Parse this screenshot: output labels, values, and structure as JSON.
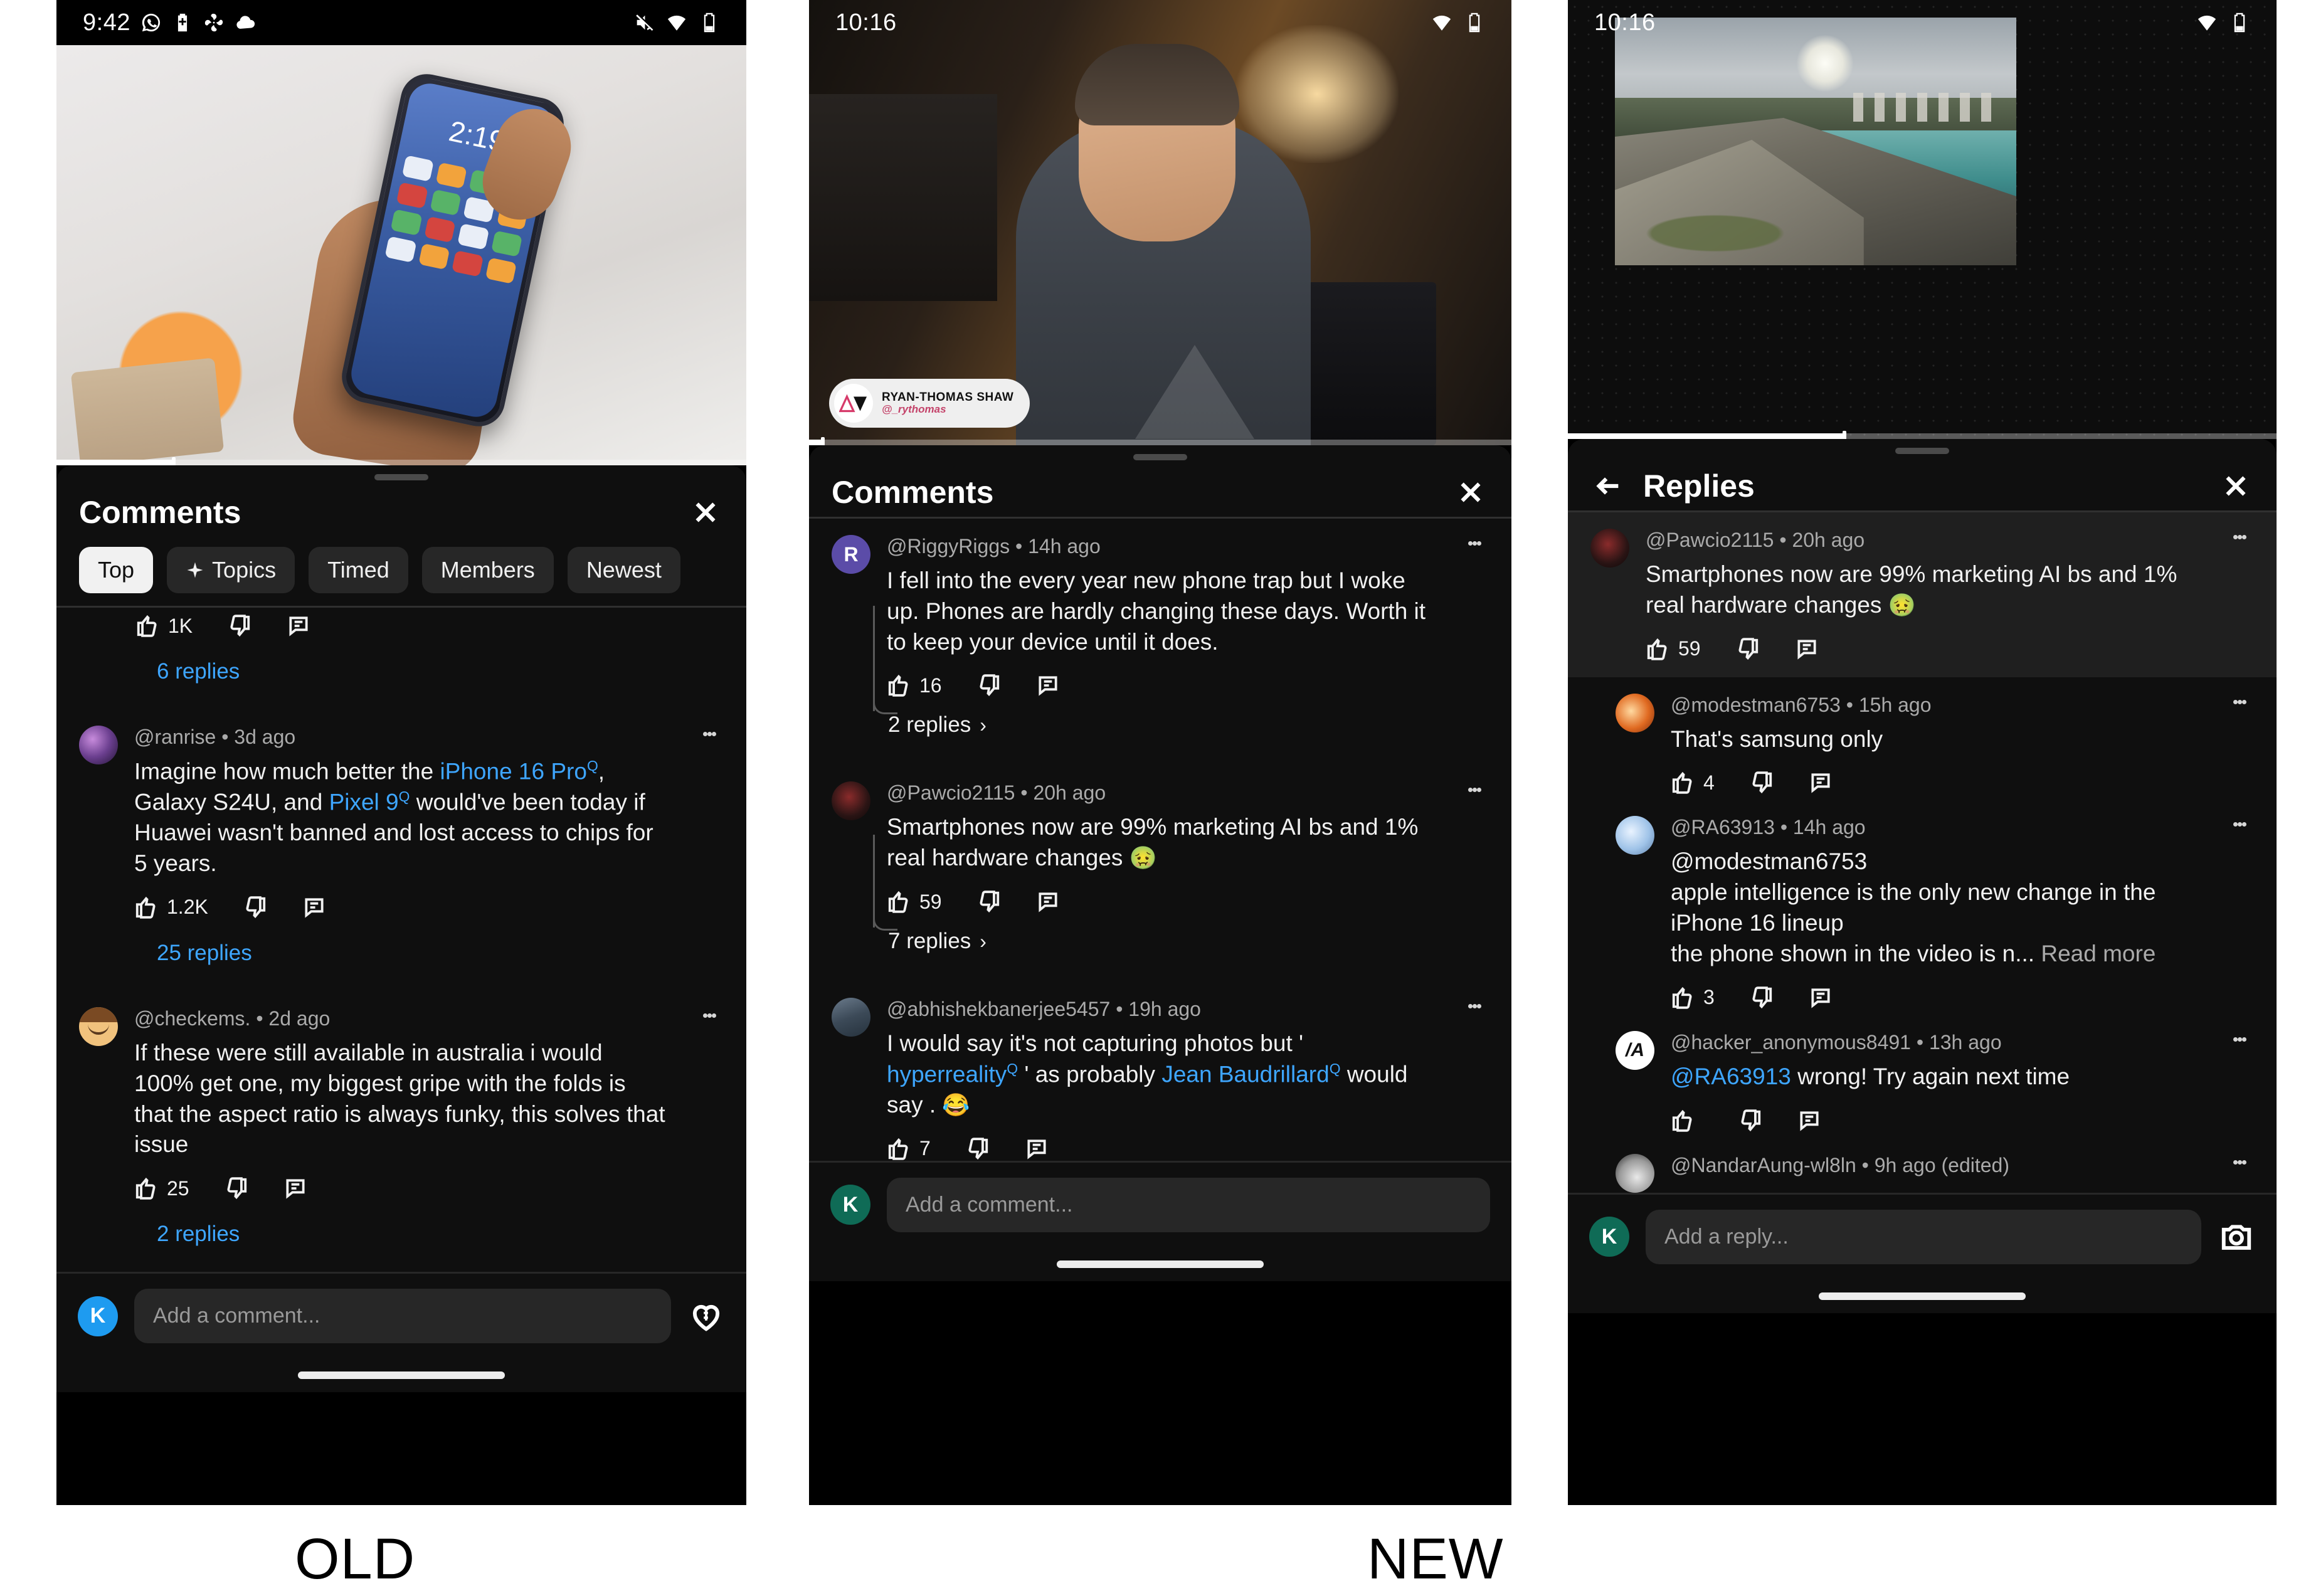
{
  "captions": {
    "old": "OLD",
    "new": "NEW"
  },
  "panels": {
    "old": {
      "status": {
        "time": "9:42",
        "icons": [
          "whatsapp-icon",
          "battery-saver-icon",
          "fan-icon",
          "cloud-icon"
        ],
        "right_icons": [
          "mute-icon",
          "wifi-icon",
          "battery-icon"
        ]
      },
      "player": {
        "progress_percent": 17
      },
      "sheet": {
        "title": "Comments",
        "close_label": "✕",
        "chips": [
          {
            "label": "Top",
            "active": true,
            "icon": ""
          },
          {
            "label": "Topics",
            "active": false,
            "icon": "sparkle-icon"
          },
          {
            "label": "Timed",
            "active": false,
            "icon": ""
          },
          {
            "label": "Members",
            "active": false,
            "icon": ""
          },
          {
            "label": "Newest",
            "active": false,
            "icon": ""
          }
        ]
      },
      "partial_row": {
        "likes": "1K"
      },
      "first_replies_link": "6 replies",
      "comments": [
        {
          "author": "@ranrise",
          "sep": "•",
          "time": "3d ago",
          "text_parts": [
            {
              "t": "Imagine how much better the ",
              "k": "plain"
            },
            {
              "t": "iPhone 16 Pro",
              "k": "link"
            },
            {
              "t": ", Galaxy S24U, and ",
              "k": "plain"
            },
            {
              "t": "Pixel 9",
              "k": "link"
            },
            {
              "t": " would've been today if Huawei wasn't banned and lost access to chips for 5 years.",
              "k": "plain"
            }
          ],
          "likes": "1.2K",
          "replies_link": "25 replies"
        },
        {
          "author": "@checkems.",
          "sep": "•",
          "time": "2d ago",
          "text_parts": [
            {
              "t": "If these were still available in australia i would 100% get one, my biggest gripe with the folds is that the aspect ratio is always funky, this solves that issue",
              "k": "plain"
            }
          ],
          "likes": "25",
          "replies_link": "2 replies"
        }
      ],
      "composer": {
        "avatar_letter": "K",
        "avatar_color": "#1e9bf0",
        "placeholder": "Add a comment...",
        "action_icon": "heart-dollar-icon"
      }
    },
    "new_comments": {
      "status": {
        "time": "10:16",
        "icons": [],
        "right_icons": [
          "wifi-icon",
          "battery-icon"
        ]
      },
      "player": {
        "progress_percent": 2,
        "watermark": {
          "name": "RYAN-THOMAS SHAW",
          "handle": "@_rythomas"
        }
      },
      "sheet": {
        "title": "Comments",
        "close_label": "✕"
      },
      "comments": [
        {
          "author": "@RiggyRiggs",
          "sep": "•",
          "time": "14h ago",
          "text_parts": [
            {
              "t": "I fell into the every year new phone trap but I woke up. Phones are hardly changing these days. Worth it to keep your device until it does.",
              "k": "plain"
            }
          ],
          "likes": "16",
          "replies_link": "2 replies",
          "replies_chevron": "›"
        },
        {
          "author": "@Pawcio2115",
          "sep": "•",
          "time": "20h ago",
          "text_parts": [
            {
              "t": "Smartphones now are 99% marketing AI bs and 1% real hardware changes ",
              "k": "plain"
            },
            {
              "t": "🤢",
              "k": "emoji"
            }
          ],
          "likes": "59",
          "replies_link": "7 replies",
          "replies_chevron": "›"
        },
        {
          "author": "@abhishekbanerjee5457",
          "sep": "•",
          "time": "19h ago",
          "text_parts": [
            {
              "t": "I would say it's not capturing photos but ' ",
              "k": "plain"
            },
            {
              "t": "hyperreality",
              "k": "link"
            },
            {
              "t": " ' as probably ",
              "k": "plain"
            },
            {
              "t": "Jean Baudrillard",
              "k": "link"
            },
            {
              "t": " would say . ",
              "k": "plain"
            },
            {
              "t": "😂",
              "k": "emoji"
            }
          ],
          "likes": "7",
          "replies_link": "",
          "replies_chevron": ""
        }
      ],
      "composer": {
        "avatar_letter": "K",
        "avatar_color": "#0f6b56",
        "placeholder": "Add a comment...",
        "action_icon": ""
      }
    },
    "new_replies": {
      "status": {
        "time": "10:16",
        "icons": [],
        "right_icons": [
          "wifi-icon",
          "battery-icon"
        ]
      },
      "player": {
        "progress_percent": 39
      },
      "sheet": {
        "title": "Replies",
        "back_label": "←",
        "close_label": "✕"
      },
      "parent_comment": {
        "author": "@Pawcio2115",
        "sep": "•",
        "time": "20h ago",
        "text_parts": [
          {
            "t": "Smartphones now are 99% marketing AI bs and 1% real hardware changes ",
            "k": "plain"
          },
          {
            "t": "🤢",
            "k": "emoji"
          }
        ],
        "likes": "59"
      },
      "replies": [
        {
          "author": "@modestman6753",
          "sep": "•",
          "time": "15h ago",
          "text_parts": [
            {
              "t": "That's samsung only",
              "k": "plain"
            }
          ],
          "likes": "4"
        },
        {
          "author": "@RA63913",
          "sep": "•",
          "time": "14h ago",
          "text_parts": [
            {
              "t": "@modestman6753",
              "k": "plain"
            },
            {
              "t": "\n",
              "k": "br"
            },
            {
              "t": "apple intelligence is the only new change in the iPhone 16 lineup",
              "k": "plain"
            },
            {
              "t": "\n",
              "k": "br"
            },
            {
              "t": "the phone shown in the video is n...",
              "k": "plain"
            },
            {
              "t": " Read more",
              "k": "readmore"
            }
          ],
          "likes": "3"
        },
        {
          "author": "@hacker_anonymous8491",
          "sep": "•",
          "time": "13h ago",
          "text_parts": [
            {
              "t": "@RA63913",
              "k": "mention"
            },
            {
              "t": " wrong! Try again next time",
              "k": "plain"
            }
          ],
          "likes": ""
        },
        {
          "author": "@NandarAung-wl8ln",
          "sep": "•",
          "time": "9h ago (edited)",
          "text_parts": [],
          "likes": ""
        }
      ],
      "composer": {
        "avatar_letter": "K",
        "avatar_color": "#0f6b56",
        "placeholder": "Add a reply...",
        "action_icon": "camera-icon"
      }
    }
  }
}
